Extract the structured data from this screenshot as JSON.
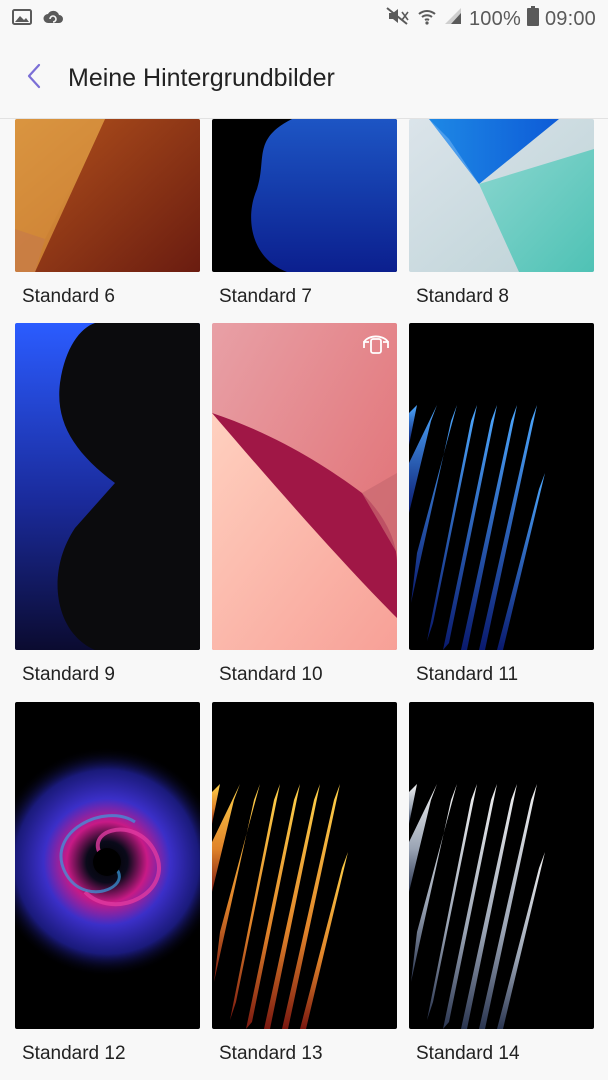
{
  "status_bar": {
    "battery": "100%",
    "time": "09:00",
    "left_icons": [
      "image-icon",
      "sync-cloud-icon"
    ],
    "right_icons": [
      "mute-icon",
      "wifi-icon",
      "signal-icon",
      "battery-icon"
    ]
  },
  "header": {
    "title": "Meine Hintergrundbilder",
    "back_icon": "chevron-left-icon",
    "accent": "#7b6fd6"
  },
  "wallpapers": [
    {
      "label": "Standard 6"
    },
    {
      "label": "Standard 7"
    },
    {
      "label": "Standard 8"
    },
    {
      "label": "Standard 9"
    },
    {
      "label": "Standard 10",
      "badge": "motion-wallpaper-icon"
    },
    {
      "label": "Standard 11"
    },
    {
      "label": "Standard 12"
    },
    {
      "label": "Standard 13"
    },
    {
      "label": "Standard 14"
    }
  ]
}
